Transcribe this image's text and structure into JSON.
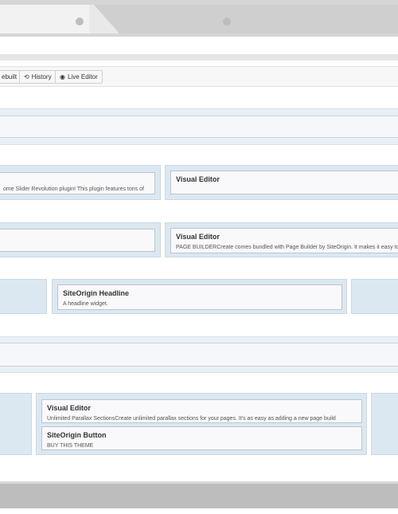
{
  "toolbar": {
    "prebuilt_label": "ebuilt",
    "history_label": "History",
    "live_editor_label": "Live Editor",
    "history_icon": "undo-icon",
    "live_editor_icon": "eye-icon"
  },
  "rows": {
    "row3_left_desc": "ome Slider Revolution plugin! This plugin features tons of",
    "row3_right_title": "Visual Editor",
    "row4_right_title": "Visual Editor",
    "row4_right_desc": "PAGE BUILDERCreate comes bundled with Page Builder by SiteOrigin. It makes it easy to b",
    "row5_mid_title": "SiteOrigin Headline",
    "row5_mid_desc": "A headline widget.",
    "row7_title_1": "Visual Editor",
    "row7_desc_1": "Unlimited Parallax SectionsCreate unlimited parallax sections for your pages. It's as easy as adding a new page build",
    "row7_title_2": "SiteOrigin Button",
    "row7_desc_2": "BUY THIS THEME"
  },
  "colors": {
    "row_bg": "#e9f0f5",
    "cell_bg": "#dce8f1",
    "widget_bg": "#f9f9fb",
    "chrome": "#d6d6d6"
  }
}
